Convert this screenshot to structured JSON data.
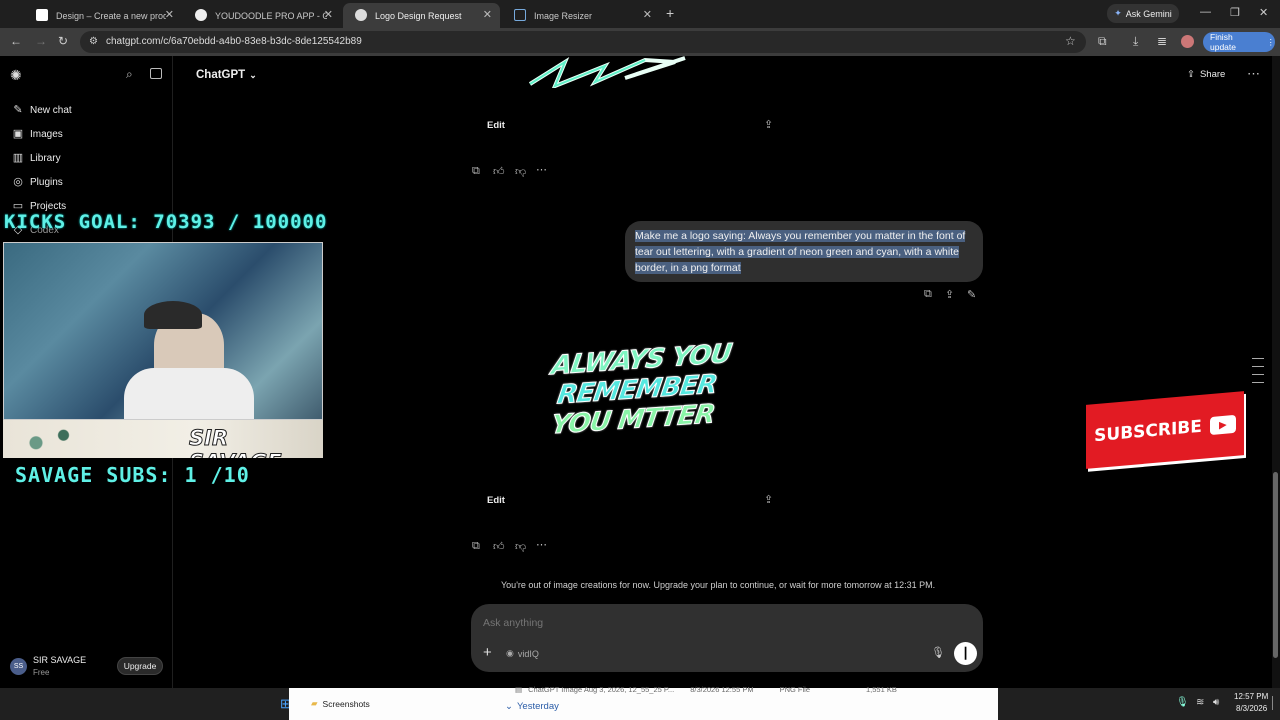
{
  "browser": {
    "tabs": [
      {
        "label": "Design – Create a new product",
        "active": false
      },
      {
        "label": "YOUDOODLE PRO APP - Google",
        "active": false
      },
      {
        "label": "Logo Design Request",
        "active": true
      },
      {
        "label": "Image Resizer",
        "active": false
      }
    ],
    "ask_gemini": "Ask Gemini",
    "url": "chatgpt.com/c/6a70ebdd-a4b0-83e8-b3dc-8de125542b89",
    "finish_update": "Finish update"
  },
  "sidebar": {
    "items": [
      {
        "label": "New chat",
        "icon": "edit-icon"
      },
      {
        "label": "Images",
        "icon": "image-icon"
      },
      {
        "label": "Library",
        "icon": "library-icon"
      },
      {
        "label": "Plugins",
        "icon": "plugins-icon"
      },
      {
        "label": "Projects",
        "icon": "folder-icon"
      },
      {
        "label": "Codex",
        "icon": "codex-icon"
      }
    ],
    "user": {
      "initials": "SS",
      "name": "SIR SAVAGE",
      "plan": "Free",
      "upgrade": "Upgrade"
    }
  },
  "header": {
    "title": "ChatGPT",
    "share": "Share"
  },
  "conversation": {
    "edit_label": "Edit",
    "user_message": "Make me a logo saying: Always you remember you matter in the font of tear out lettering, with a gradient of neon green and cyan, with a white border, in a png format",
    "generated_logo": {
      "lines": [
        "ALWAYS YOU",
        "REMEMBER",
        "YOU MTTER"
      ]
    },
    "limit_notice": "You're out of image creations for now. Upgrade your plan to continue, or wait for more tomorrow at 12:31 PM."
  },
  "composer": {
    "placeholder": "Ask anything",
    "tool": "vidIQ"
  },
  "overlays": {
    "kicks_goal": "KICKS GOAL: 70393 / 100000",
    "savage_subs": "SAVAGE SUBS: 1  /10",
    "cam_banner": "SIR SAVAGE",
    "subscribe": "SUBSCRIBE"
  },
  "explorer": {
    "folder": "Screenshots",
    "file_name": "ChatGPT Image Aug 3, 2026, 12_55_25 P...",
    "file_date": "8/3/2026 12:55 PM",
    "file_type": "PNG File",
    "file_size": "1,551 KB",
    "group": "Yesterday"
  },
  "taskbar": {
    "time": "12:57 PM",
    "date": "8/3/2026"
  },
  "colors": {
    "accent_cyan": "#5ff0e6",
    "subscribe_red": "#e21b23",
    "finish_update_blue": "#4a7fd1"
  }
}
